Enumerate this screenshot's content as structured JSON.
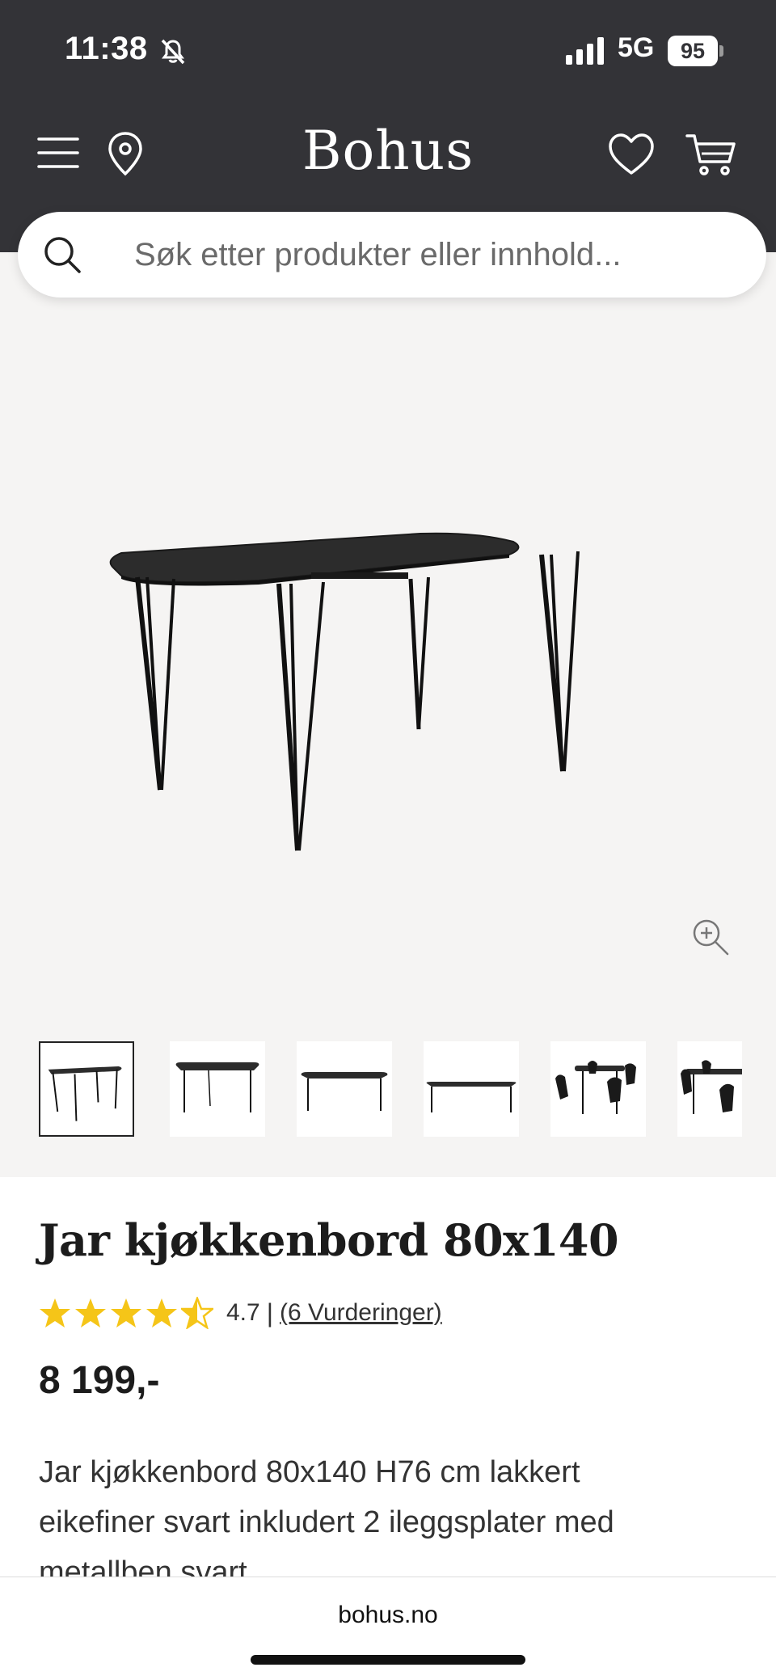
{
  "status_bar": {
    "time": "11:38",
    "network": "5G",
    "battery": "95",
    "icons": [
      "bell-muted-icon",
      "signal-icon",
      "battery-icon"
    ]
  },
  "header": {
    "brand": "Bohus",
    "background_color": "#333337",
    "icons": [
      "menu-icon",
      "location-pin-icon",
      "heart-icon",
      "cart-icon"
    ]
  },
  "search": {
    "placeholder": "Søk etter produkter eller innhold...",
    "value": ""
  },
  "gallery": {
    "background_color": "#f5f4f3",
    "thumbnail_count": 6,
    "active_thumbnail": 1,
    "icons": [
      "zoom-in-icon"
    ]
  },
  "product": {
    "title": "Jar kjøkkenbord 80x140",
    "rating": 4.5,
    "rating_label": "4.7",
    "rating_separator": "|",
    "reviews_label": "(6 Vurderinger)",
    "star_color": "#f5c518",
    "price": "8 199,-",
    "description": "Jar kjøkkenbord 80x140 H76 cm lakkert eikefiner svart inkludert 2 ileggsplater med metallben svart"
  },
  "browser": {
    "url": "bohus.no"
  }
}
